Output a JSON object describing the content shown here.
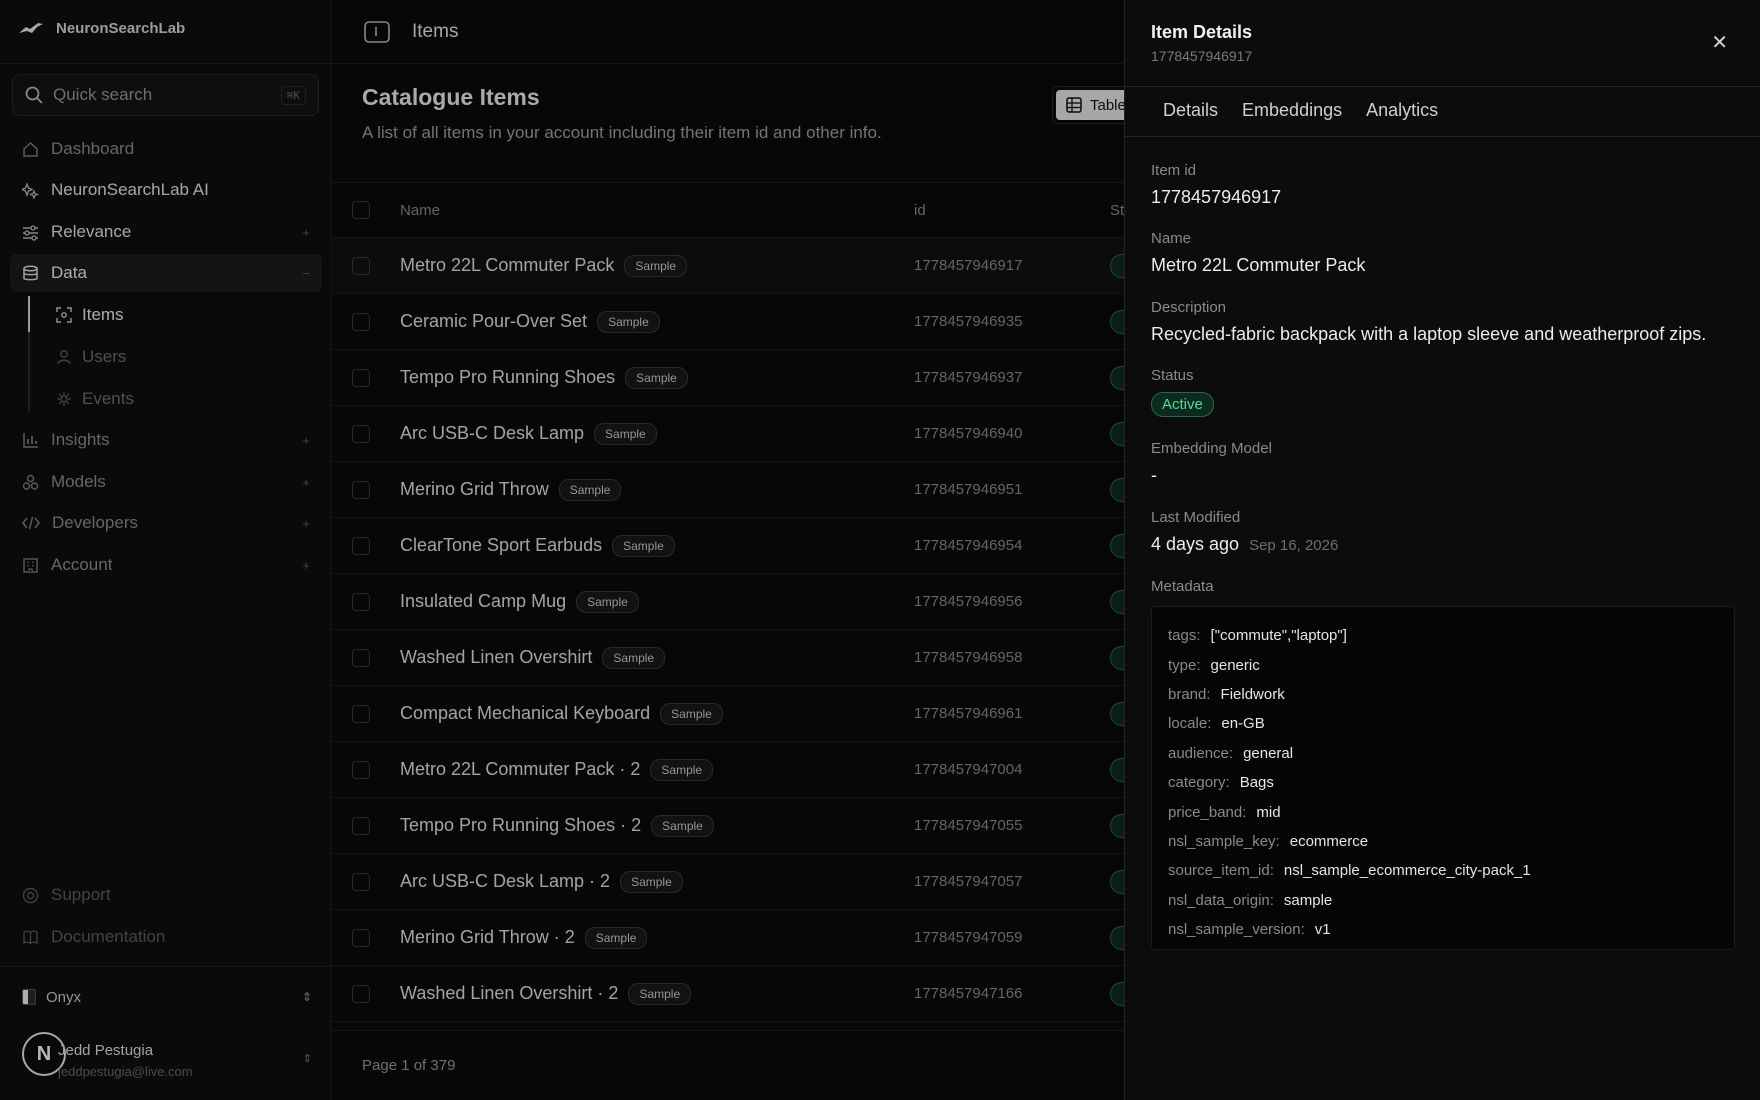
{
  "brand": {
    "name": "NeuronSearchLab"
  },
  "search": {
    "label": "Quick search",
    "shortcut": "⌘K"
  },
  "nav": {
    "dashboard": "Dashboard",
    "ai": "NeuronSearchLab AI",
    "relevance": "Relevance",
    "data": "Data",
    "items": "Items",
    "users": "Users",
    "events": "Events",
    "insights": "Insights",
    "models": "Models",
    "developers": "Developers",
    "account": "Account",
    "support": "Support",
    "documentation": "Documentation"
  },
  "workspace": {
    "name": "Onyx"
  },
  "user": {
    "initial": "N",
    "name": "Jedd Pestugia",
    "email": "jeddpestugia@live.com"
  },
  "topbar": {
    "title": "Items"
  },
  "page": {
    "title": "Catalogue Items",
    "subtitle": "A list of all items in your account including their item id and other info.",
    "view_label": "Table"
  },
  "table": {
    "headers": {
      "name": "Name",
      "id": "id",
      "status": "St"
    },
    "sample_label": "Sample",
    "rows": [
      {
        "name": "Metro 22L Commuter Pack",
        "id": "1778457946917"
      },
      {
        "name": "Ceramic Pour-Over Set",
        "id": "1778457946935"
      },
      {
        "name": "Tempo Pro Running Shoes",
        "id": "1778457946937"
      },
      {
        "name": "Arc USB-C Desk Lamp",
        "id": "1778457946940"
      },
      {
        "name": "Merino Grid Throw",
        "id": "1778457946951"
      },
      {
        "name": "ClearTone Sport Earbuds",
        "id": "1778457946954"
      },
      {
        "name": "Insulated Camp Mug",
        "id": "1778457946956"
      },
      {
        "name": "Washed Linen Overshirt",
        "id": "1778457946958"
      },
      {
        "name": "Compact Mechanical Keyboard",
        "id": "1778457946961"
      },
      {
        "name": "Metro 22L Commuter Pack · 2",
        "id": "1778457947004"
      },
      {
        "name": "Tempo Pro Running Shoes · 2",
        "id": "1778457947055"
      },
      {
        "name": "Arc USB-C Desk Lamp · 2",
        "id": "1778457947057"
      },
      {
        "name": "Merino Grid Throw · 2",
        "id": "1778457947059"
      },
      {
        "name": "Washed Linen Overshirt · 2",
        "id": "1778457947166"
      }
    ]
  },
  "pagination": {
    "text": "Page 1 of 379"
  },
  "details": {
    "title": "Item Details",
    "subtitle": "1778457946917",
    "tabs": [
      "Details",
      "Embeddings",
      "Analytics"
    ],
    "item_id_label": "Item id",
    "item_id": "1778457946917",
    "name_label": "Name",
    "name": "Metro 22L Commuter Pack",
    "description_label": "Description",
    "description": "Recycled-fabric backpack with a laptop sleeve and weatherproof zips.",
    "status_label": "Status",
    "status": "Active",
    "embedding_label": "Embedding Model",
    "embedding": "-",
    "modified_label": "Last Modified",
    "modified_rel": "4 days ago",
    "modified_date": "Sep 16, 2026",
    "metadata_label": "Metadata",
    "metadata": [
      {
        "k": "tags:",
        "v": "[\"commute\",\"laptop\"]"
      },
      {
        "k": "type:",
        "v": "generic"
      },
      {
        "k": "brand:",
        "v": "Fieldwork"
      },
      {
        "k": "locale:",
        "v": "en-GB"
      },
      {
        "k": "audience:",
        "v": "general"
      },
      {
        "k": "category:",
        "v": "Bags"
      },
      {
        "k": "price_band:",
        "v": "mid"
      },
      {
        "k": "nsl_sample_key:",
        "v": "ecommerce"
      },
      {
        "k": "source_item_id:",
        "v": "nsl_sample_ecommerce_city-pack_1"
      },
      {
        "k": "nsl_data_origin:",
        "v": "sample"
      },
      {
        "k": "nsl_sample_version:",
        "v": "v1"
      }
    ]
  },
  "colors": {
    "accent_green": "#4ddf9a",
    "background": "#0b0b0c"
  }
}
